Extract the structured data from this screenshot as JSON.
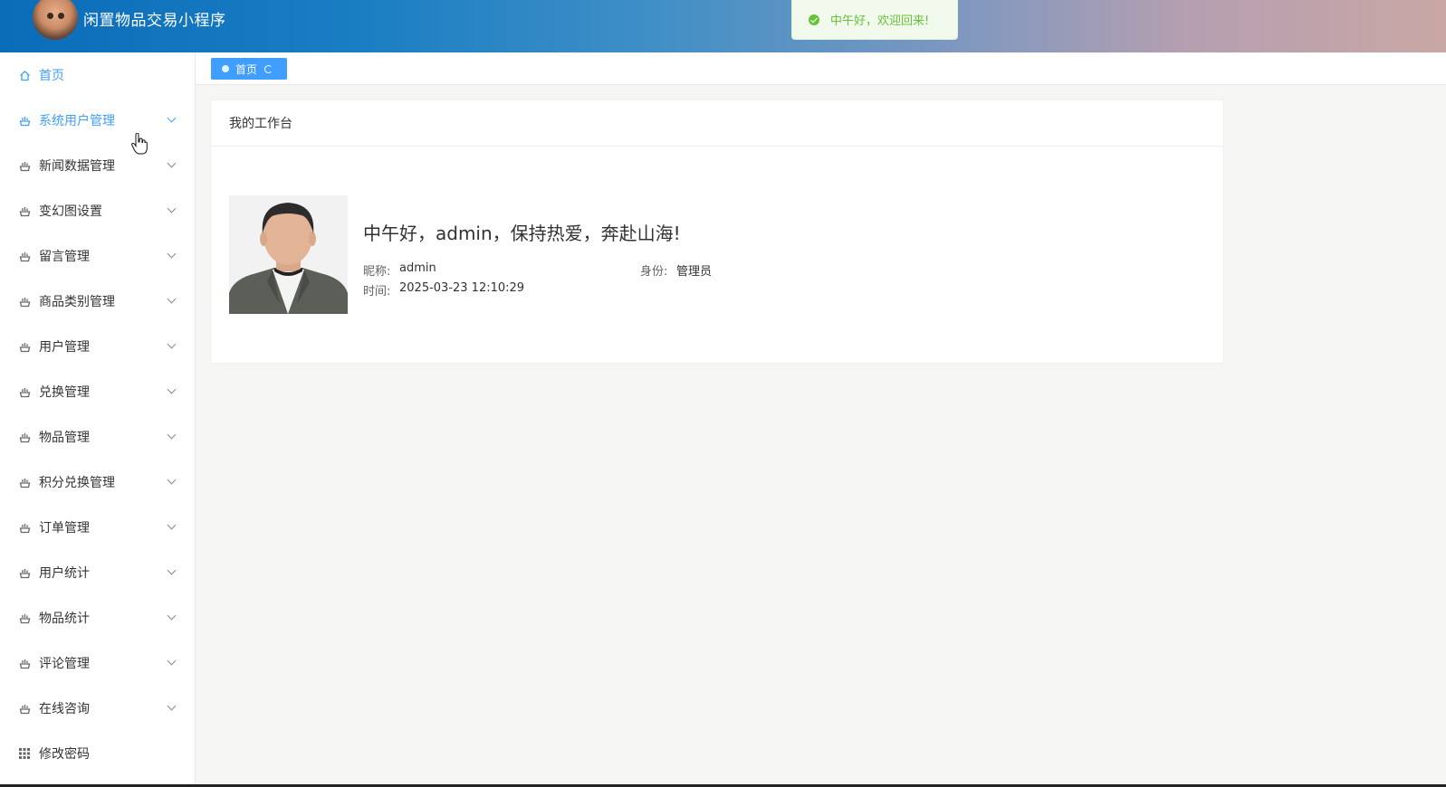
{
  "header": {
    "app_title": "闲置物品交易小程序",
    "logo_icon": "cartoon-avatar-logo"
  },
  "toast": {
    "message": "中午好，欢迎回来!",
    "type": "success",
    "color": "#67c23a"
  },
  "sidebar": {
    "accent_color": "#409eff",
    "items": [
      {
        "label": "首页",
        "icon": "home-icon",
        "has_submenu": false,
        "active": true
      },
      {
        "label": "系统用户管理",
        "icon": "module-icon",
        "has_submenu": true,
        "active": true
      },
      {
        "label": "新闻数据管理",
        "icon": "module-icon",
        "has_submenu": true
      },
      {
        "label": "变幻图设置",
        "icon": "module-icon",
        "has_submenu": true
      },
      {
        "label": "留言管理",
        "icon": "module-icon",
        "has_submenu": true
      },
      {
        "label": "商品类别管理",
        "icon": "module-icon",
        "has_submenu": true
      },
      {
        "label": "用户管理",
        "icon": "module-icon",
        "has_submenu": true
      },
      {
        "label": "兑换管理",
        "icon": "module-icon",
        "has_submenu": true
      },
      {
        "label": "物品管理",
        "icon": "module-icon",
        "has_submenu": true
      },
      {
        "label": "积分兑换管理",
        "icon": "module-icon",
        "has_submenu": true
      },
      {
        "label": "订单管理",
        "icon": "module-icon",
        "has_submenu": true
      },
      {
        "label": "用户统计",
        "icon": "module-icon",
        "has_submenu": true
      },
      {
        "label": "物品统计",
        "icon": "module-icon",
        "has_submenu": true
      },
      {
        "label": "评论管理",
        "icon": "module-icon",
        "has_submenu": true
      },
      {
        "label": "在线咨询",
        "icon": "module-icon",
        "has_submenu": true
      },
      {
        "label": "修改密码",
        "icon": "grid-icon",
        "has_submenu": false
      }
    ]
  },
  "tabs": [
    {
      "label": "首页",
      "active": true
    }
  ],
  "workbench": {
    "title": "我的工作台",
    "greeting": "中午好，admin，保持热爱，奔赴山海!",
    "nickname_label": "昵称:",
    "nickname": "admin",
    "role_label": "身份:",
    "role": "管理员",
    "time_label": "时间:",
    "time": "2025-03-23 12:10:29"
  }
}
